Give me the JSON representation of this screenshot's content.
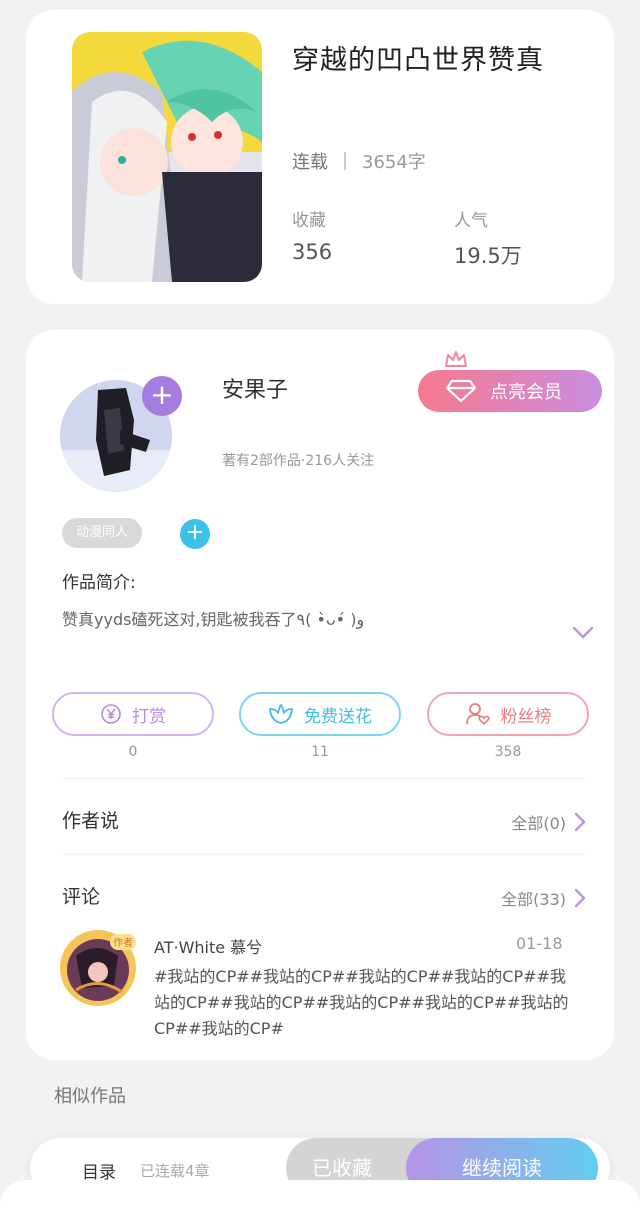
{
  "colors": {
    "accent_purple": "#a57de0",
    "accent_blue": "#3cc2e8",
    "accent_pink": "#e77c86",
    "background": "#f2f2f2"
  },
  "book": {
    "title": "穿越的凹凸世界赞真",
    "status": "连载",
    "word_count": "3654字",
    "favorites_label": "收藏",
    "favorites_value": "356",
    "popularity_label": "人气",
    "popularity_value": "19.5万"
  },
  "author": {
    "name": "安果子",
    "stats": "著有2部作品·216人关注",
    "vip_button": "点亮会员",
    "tag": "动漫同人",
    "intro_label": "作品简介:",
    "intro_text": "赞真yyds磕死这对,钥匙被我吞了٩( •̀ᴗ•́ )و"
  },
  "actions": [
    {
      "label": "打赏",
      "count": "0",
      "icon": "yen-icon"
    },
    {
      "label": "免费送花",
      "count": "11",
      "icon": "flower-icon"
    },
    {
      "label": "粉丝榜",
      "count": "358",
      "icon": "fans-icon"
    }
  ],
  "author_says": {
    "title": "作者说",
    "link": "全部(0)"
  },
  "comments": {
    "title": "评论",
    "link": "全部(33)",
    "items": [
      {
        "user": "AT·White 慕兮",
        "date": "01-18",
        "text": "#我站的CP##我站的CP##我站的CP##我站的CP##我站的CP##我站的CP##我站的CP##我站的CP##我站的CP##我站的CP#",
        "badge": "作者"
      }
    ]
  },
  "similar_label": "相似作品",
  "bottom_bar": {
    "toc_label": "目录",
    "toc_count": "已连载4章",
    "saved_label": "已收藏",
    "read_label": "继续阅读"
  }
}
